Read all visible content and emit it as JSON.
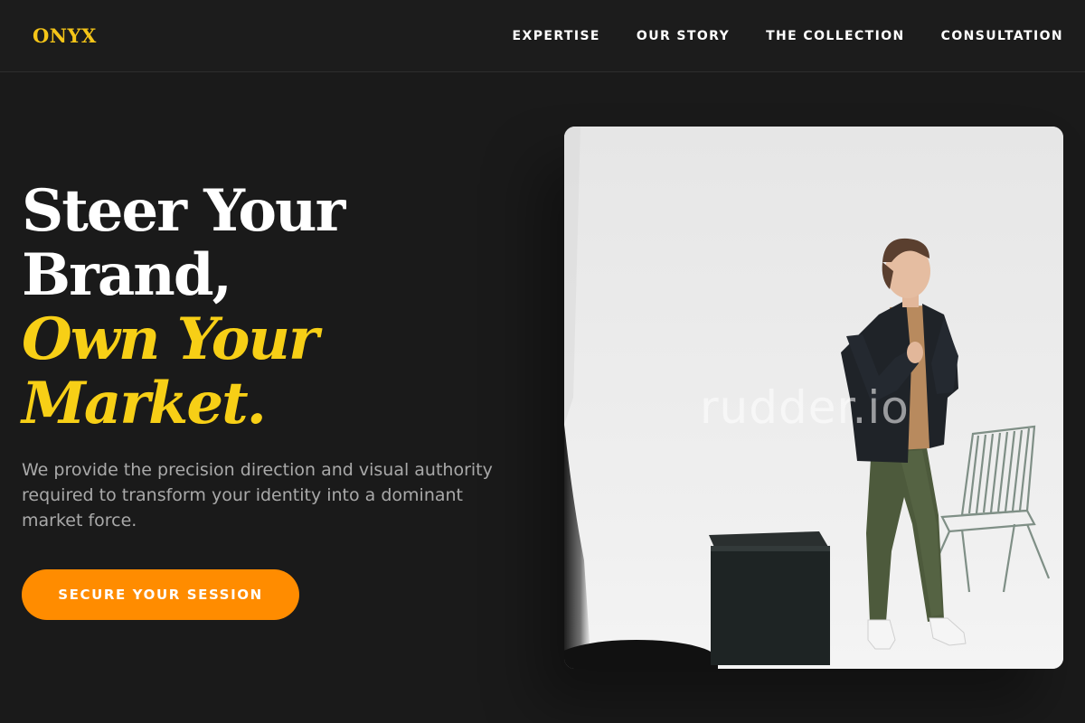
{
  "brand": {
    "logo": "ONYX",
    "accent_color": "#f5c518"
  },
  "nav": {
    "items": [
      {
        "label": "EXPERTISE"
      },
      {
        "label": "OUR STORY"
      },
      {
        "label": "THE COLLECTION"
      },
      {
        "label": "CONSULTATION"
      }
    ]
  },
  "hero": {
    "title_line1": "Steer Your",
    "title_line2": "Brand,",
    "title_accent_line1": "Own Your",
    "title_accent_line2": "Market.",
    "description": "We provide the precision direction and visual authority required to transform your identity into a dominant market force.",
    "cta_label": "SECURE YOUR SESSION",
    "cta_color": "#ff8c00"
  },
  "photo": {
    "watermark": "rudder.io",
    "alt": "Man in dark blazer and green trousers standing in a white studio next to a black cube and a wire chair"
  }
}
